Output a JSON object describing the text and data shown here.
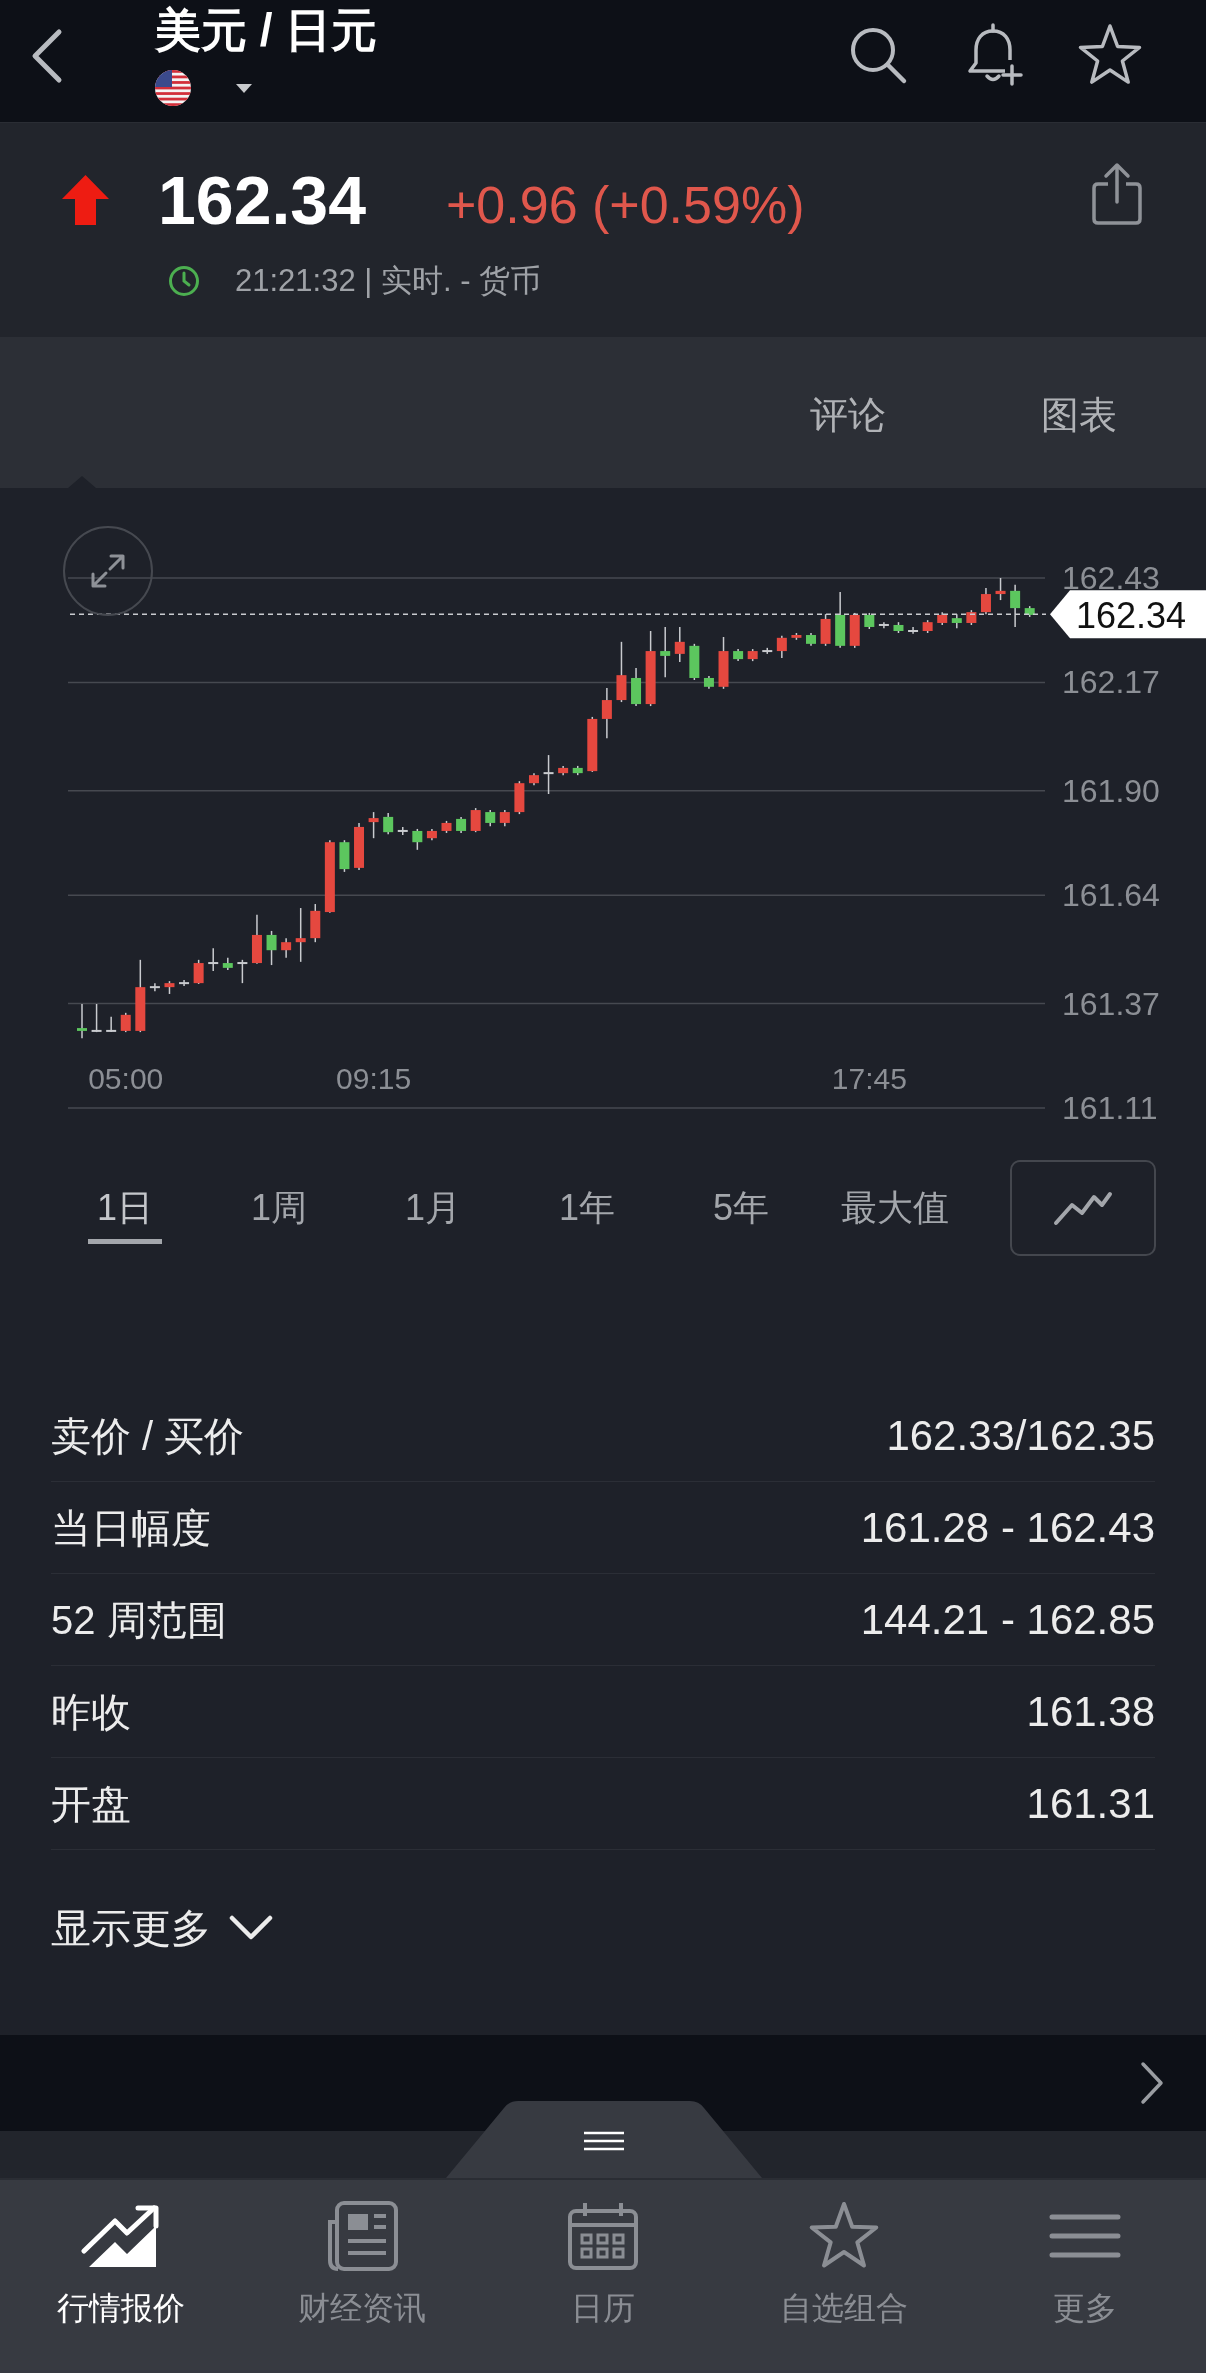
{
  "header": {
    "title": "美元 / 日元"
  },
  "quote": {
    "price": "162.34",
    "change": "+0.96 (+0.59%)",
    "rising": true,
    "timestamp": "21:21:32 | 实时. - 货币"
  },
  "tabs": [
    {
      "label": "评论",
      "selected": false
    },
    {
      "label": "图表",
      "selected": false
    }
  ],
  "chart": {
    "chart_data": {
      "type": "candlestick",
      "categories": [
        null,
        null,
        null,
        "05:00",
        null,
        null,
        null,
        null,
        null,
        null,
        null,
        null,
        null,
        null,
        null,
        null,
        null,
        null,
        null,
        null,
        "09:15",
        null,
        null,
        null,
        null,
        null,
        null,
        null,
        null,
        null,
        null,
        null,
        null,
        null,
        null,
        null,
        null,
        null,
        null,
        null,
        null,
        null,
        null,
        null,
        null,
        null,
        null,
        null,
        null,
        null,
        null,
        null,
        null,
        null,
        "17:45",
        null,
        null,
        null,
        null,
        null,
        null,
        null,
        null,
        null,
        null,
        null
      ],
      "ohlc": [
        [
          161.309,
          161.369,
          161.284,
          161.302
        ],
        [
          161.302,
          161.369,
          161.299,
          161.302
        ],
        [
          161.302,
          161.337,
          161.299,
          161.302
        ],
        [
          161.302,
          161.347,
          161.299,
          161.342
        ],
        [
          161.302,
          161.479,
          161.299,
          161.411
        ],
        [
          161.411,
          161.421,
          161.401,
          161.411
        ],
        [
          161.411,
          161.426,
          161.394,
          161.421
        ],
        [
          161.421,
          161.429,
          161.414,
          161.421
        ],
        [
          161.421,
          161.479,
          161.419,
          161.471
        ],
        [
          161.471,
          161.508,
          161.451,
          161.471
        ],
        [
          161.471,
          161.484,
          161.454,
          161.459
        ],
        [
          161.471,
          161.479,
          161.421,
          161.471
        ],
        [
          161.471,
          161.591,
          161.469,
          161.541
        ],
        [
          161.541,
          161.551,
          161.466,
          161.503
        ],
        [
          161.503,
          161.533,
          161.484,
          161.523
        ],
        [
          161.523,
          161.608,
          161.474,
          161.533
        ],
        [
          161.533,
          161.618,
          161.523,
          161.601
        ],
        [
          161.598,
          161.777,
          161.596,
          161.772
        ],
        [
          161.772,
          161.777,
          161.698,
          161.705
        ],
        [
          161.708,
          161.82,
          161.703,
          161.81
        ],
        [
          161.822,
          161.847,
          161.782,
          161.832
        ],
        [
          161.835,
          161.845,
          161.792,
          161.797
        ],
        [
          161.8,
          161.81,
          161.79,
          161.8
        ],
        [
          161.8,
          161.805,
          161.753,
          161.772
        ],
        [
          161.782,
          161.805,
          161.777,
          161.8
        ],
        [
          161.8,
          161.825,
          161.795,
          161.82
        ],
        [
          161.83,
          161.835,
          161.795,
          161.8
        ],
        [
          161.8,
          161.857,
          161.797,
          161.852
        ],
        [
          161.847,
          161.852,
          161.812,
          161.82
        ],
        [
          161.82,
          161.852,
          161.812,
          161.847
        ],
        [
          161.847,
          161.924,
          161.842,
          161.919
        ],
        [
          161.919,
          161.944,
          161.914,
          161.939
        ],
        [
          161.944,
          161.989,
          161.892,
          161.944
        ],
        [
          161.944,
          161.962,
          161.939,
          161.957
        ],
        [
          161.957,
          161.962,
          161.939,
          161.944
        ],
        [
          161.949,
          162.084,
          161.947,
          162.079
        ],
        [
          162.079,
          162.156,
          162.031,
          162.126
        ],
        [
          162.126,
          162.271,
          162.121,
          162.188
        ],
        [
          162.181,
          162.206,
          162.111,
          162.116
        ],
        [
          162.116,
          162.298,
          162.111,
          162.248
        ],
        [
          162.248,
          162.308,
          162.183,
          162.236
        ],
        [
          162.241,
          162.308,
          162.221,
          162.271
        ],
        [
          162.261,
          162.266,
          162.176,
          162.181
        ],
        [
          162.181,
          162.186,
          162.154,
          162.159
        ],
        [
          162.159,
          162.283,
          162.154,
          162.248
        ],
        [
          162.248,
          162.253,
          162.223,
          162.228
        ],
        [
          162.228,
          162.253,
          162.223,
          162.248
        ],
        [
          162.248,
          162.256,
          162.241,
          162.248
        ],
        [
          162.248,
          162.286,
          162.231,
          162.281
        ],
        [
          162.281,
          162.293,
          162.276,
          162.288
        ],
        [
          162.288,
          162.293,
          162.261,
          162.266
        ],
        [
          162.266,
          162.34,
          162.261,
          162.328
        ],
        [
          162.338,
          162.395,
          162.256,
          162.261
        ],
        [
          162.261,
          162.343,
          162.256,
          162.338
        ],
        [
          162.338,
          162.343,
          162.303,
          162.308
        ],
        [
          162.313,
          162.32,
          162.305,
          162.313
        ],
        [
          162.313,
          162.32,
          162.293,
          162.298
        ],
        [
          162.298,
          162.308,
          162.291,
          162.298
        ],
        [
          162.298,
          162.325,
          162.293,
          162.32
        ],
        [
          162.318,
          162.345,
          162.313,
          162.338
        ],
        [
          162.33,
          162.34,
          162.305,
          162.318
        ],
        [
          162.318,
          162.35,
          162.313,
          162.345
        ],
        [
          162.345,
          162.405,
          162.34,
          162.39
        ],
        [
          162.39,
          162.43,
          162.375,
          162.398
        ],
        [
          162.398,
          162.413,
          162.308,
          162.355
        ],
        [
          162.355,
          162.36,
          162.333,
          162.338
        ]
      ],
      "yticks": [
        {
          "value": 162.43,
          "label": "162.43"
        },
        {
          "value": 162.17,
          "label": "162.17"
        },
        {
          "value": 161.9,
          "label": "161.90"
        },
        {
          "value": 161.64,
          "label": "161.64"
        },
        {
          "value": 161.37,
          "label": "161.37"
        },
        {
          "value": 161.11,
          "label": "161.11"
        }
      ],
      "ylim": [
        161.11,
        162.43
      ],
      "grid": true,
      "ref_lines": [
        {
          "axis": "y",
          "value": 162.34,
          "label": "162.34"
        }
      ]
    }
  },
  "ranges": [
    {
      "label": "1日",
      "selected": true
    },
    {
      "label": "1周",
      "selected": false
    },
    {
      "label": "1月",
      "selected": false
    },
    {
      "label": "1年",
      "selected": false
    },
    {
      "label": "5年",
      "selected": false
    },
    {
      "label": "最大值",
      "selected": false
    }
  ],
  "stats": [
    {
      "label": "卖价 / 买价",
      "value": "162.33/162.35"
    },
    {
      "label": "当日幅度",
      "value": "161.28 - 162.43"
    },
    {
      "label": "52 周范围",
      "value": "144.21 - 162.85"
    },
    {
      "label": "昨收",
      "value": "161.38"
    },
    {
      "label": "开盘",
      "value": "161.31"
    }
  ],
  "show_more": {
    "label": "显示更多"
  },
  "nav": [
    {
      "label": "行情报价",
      "selected": true
    },
    {
      "label": "财经资讯",
      "selected": false
    },
    {
      "label": "日历",
      "selected": false
    },
    {
      "label": "自选组合",
      "selected": false
    },
    {
      "label": "更多",
      "selected": false
    }
  ]
}
